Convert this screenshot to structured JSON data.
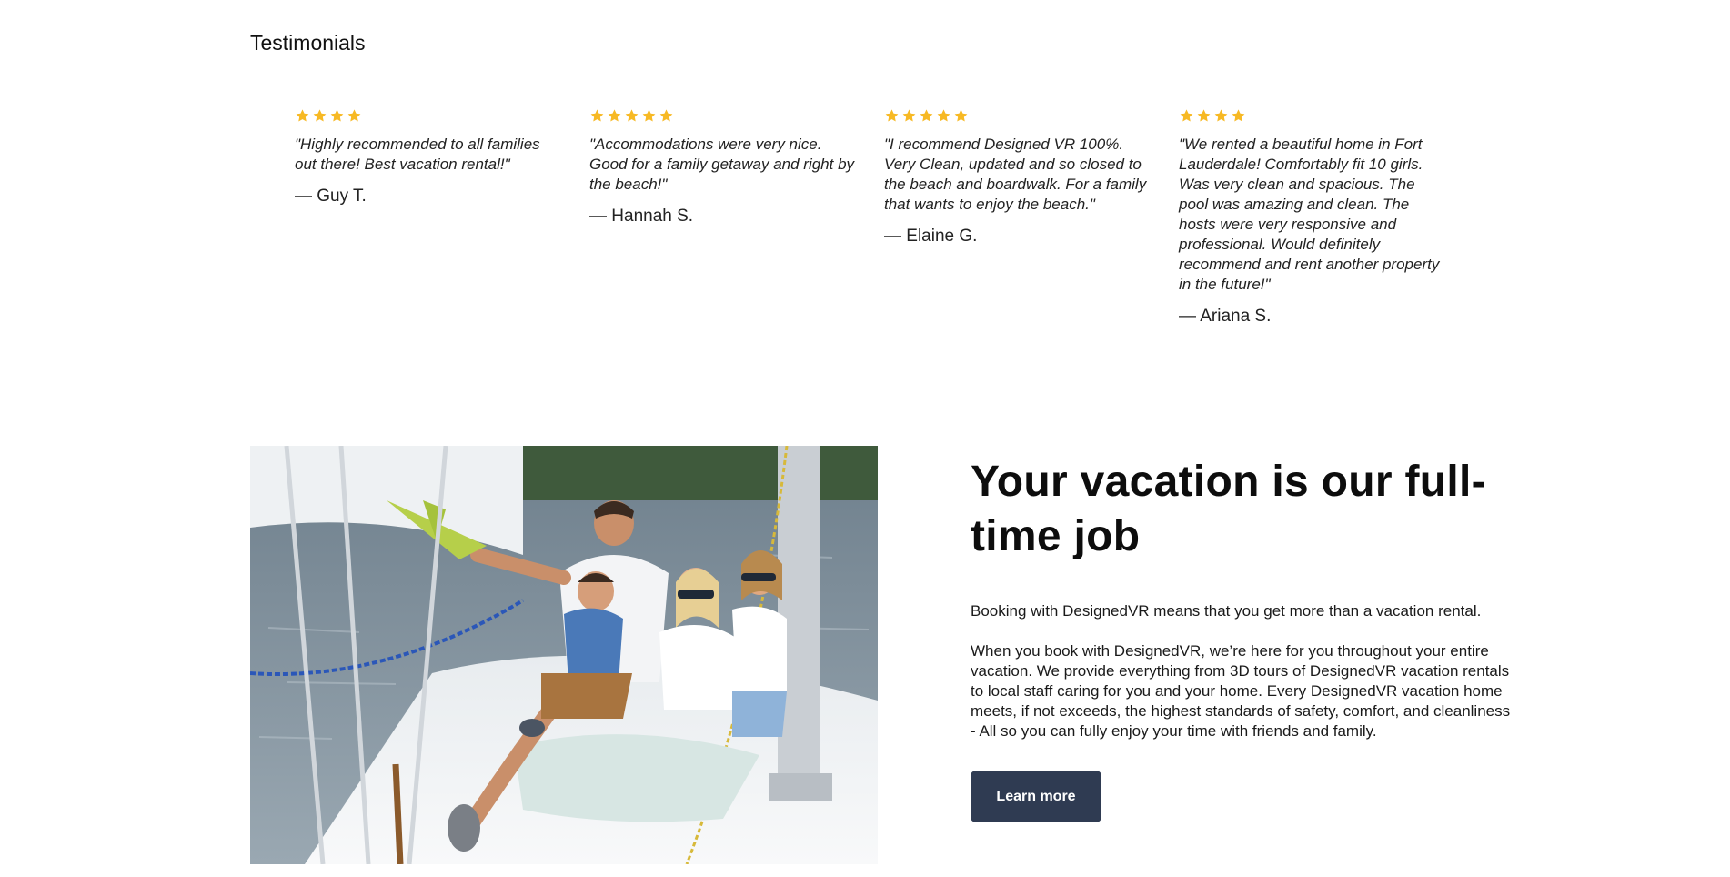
{
  "testimonials": {
    "title": "Testimonials",
    "star_color": "#f7b924",
    "items": [
      {
        "rating": 4,
        "quote": "\"Highly recommended to all families out there! Best vacation rental!\"",
        "author": "— Guy T."
      },
      {
        "rating": 5,
        "quote": "\"Accommodations were very nice. Good for a family getaway and right by the beach!\"",
        "author": "— Hannah S."
      },
      {
        "rating": 5,
        "quote": "\"I recommend Designed VR 100%. Very Clean, updated and so closed to the beach and boardwalk. For a family that wants to enjoy the beach.\"",
        "author": "— Elaine G."
      },
      {
        "rating": 4,
        "quote": "\"We rented a beautiful home in Fort Lauderdale! Comfortably fit 10 girls. Was very clean and spacious. The pool was amazing and clean. The hosts were very responsive and professional. Would definitely recommend and rent another property in the future!\"",
        "author": "— Ariana S."
      }
    ]
  },
  "promo": {
    "heading": "Your vacation is our full-time job",
    "paragraph1": "Booking with DesignedVR means that you get more than a vacation rental.",
    "paragraph2": "When you book with DesignedVR, we’re here for you throughout your entire vacation. We provide everything from 3D tours of DesignedVR vacation rentals to local staff caring for you and your home. Every DesignedVR vacation home meets, if not exceeds, the highest standards of safety, comfort, and cleanliness - All so you can fully enjoy your time with friends and family.",
    "button_label": "Learn more",
    "button_color": "#2f3b52"
  }
}
